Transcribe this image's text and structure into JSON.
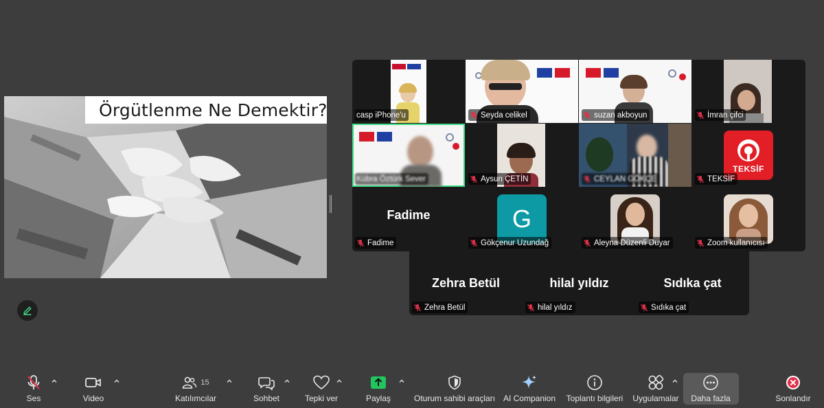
{
  "slide": {
    "title": "Örgütlenme Ne Demektir?"
  },
  "gallery": [
    {
      "name": "casp iPhone'u",
      "muted": false
    },
    {
      "name": "Seyda celikel",
      "muted": true
    },
    {
      "name": "suzan akboyun",
      "muted": true
    },
    {
      "name": "İmran çifci",
      "muted": true
    },
    {
      "name": "Kübra Öztürk Sever",
      "muted": false
    },
    {
      "name": "Aysun ÇETİN",
      "muted": true
    },
    {
      "name": "CEYLAN GÖKÇE",
      "muted": true
    },
    {
      "name": "TEKSİF",
      "muted": true
    },
    {
      "name": "Fadime",
      "muted": true,
      "display": "Fadime"
    },
    {
      "name": "Gökçenur Uzundağ",
      "muted": true,
      "avatar": "G"
    },
    {
      "name": "Aleyna Düzenli Duyar",
      "muted": true
    },
    {
      "name": "Zoom kullanıcısı",
      "muted": true
    }
  ],
  "gallery_row2": [
    {
      "name": "Zehra Betül",
      "display": "Zehra Betül",
      "muted": true
    },
    {
      "name": "hilal yıldız",
      "display": "hilal yıldız",
      "muted": true
    },
    {
      "name": "Sıdıka çat",
      "display": "Sıdıka çat",
      "muted": true
    }
  ],
  "logo_text": "TEKSİF",
  "toolbar": {
    "audio": "Ses",
    "video": "Video",
    "participants": "Katılımcılar",
    "participants_count": "15",
    "chat": "Sohbet",
    "react": "Tepki ver",
    "share": "Paylaş",
    "host_tools": "Oturum sahibi araçları",
    "ai": "AI Companion",
    "info": "Toplantı bilgileri",
    "apps": "Uygulamalar",
    "more": "Daha fazla",
    "end": "Sonlandır"
  },
  "colors": {
    "active_border": "#3ddc84",
    "muted_red": "#e0314b",
    "share_green": "#22c55e",
    "end_red": "#e0314b",
    "avatar_teal": "#0d9aa5"
  }
}
